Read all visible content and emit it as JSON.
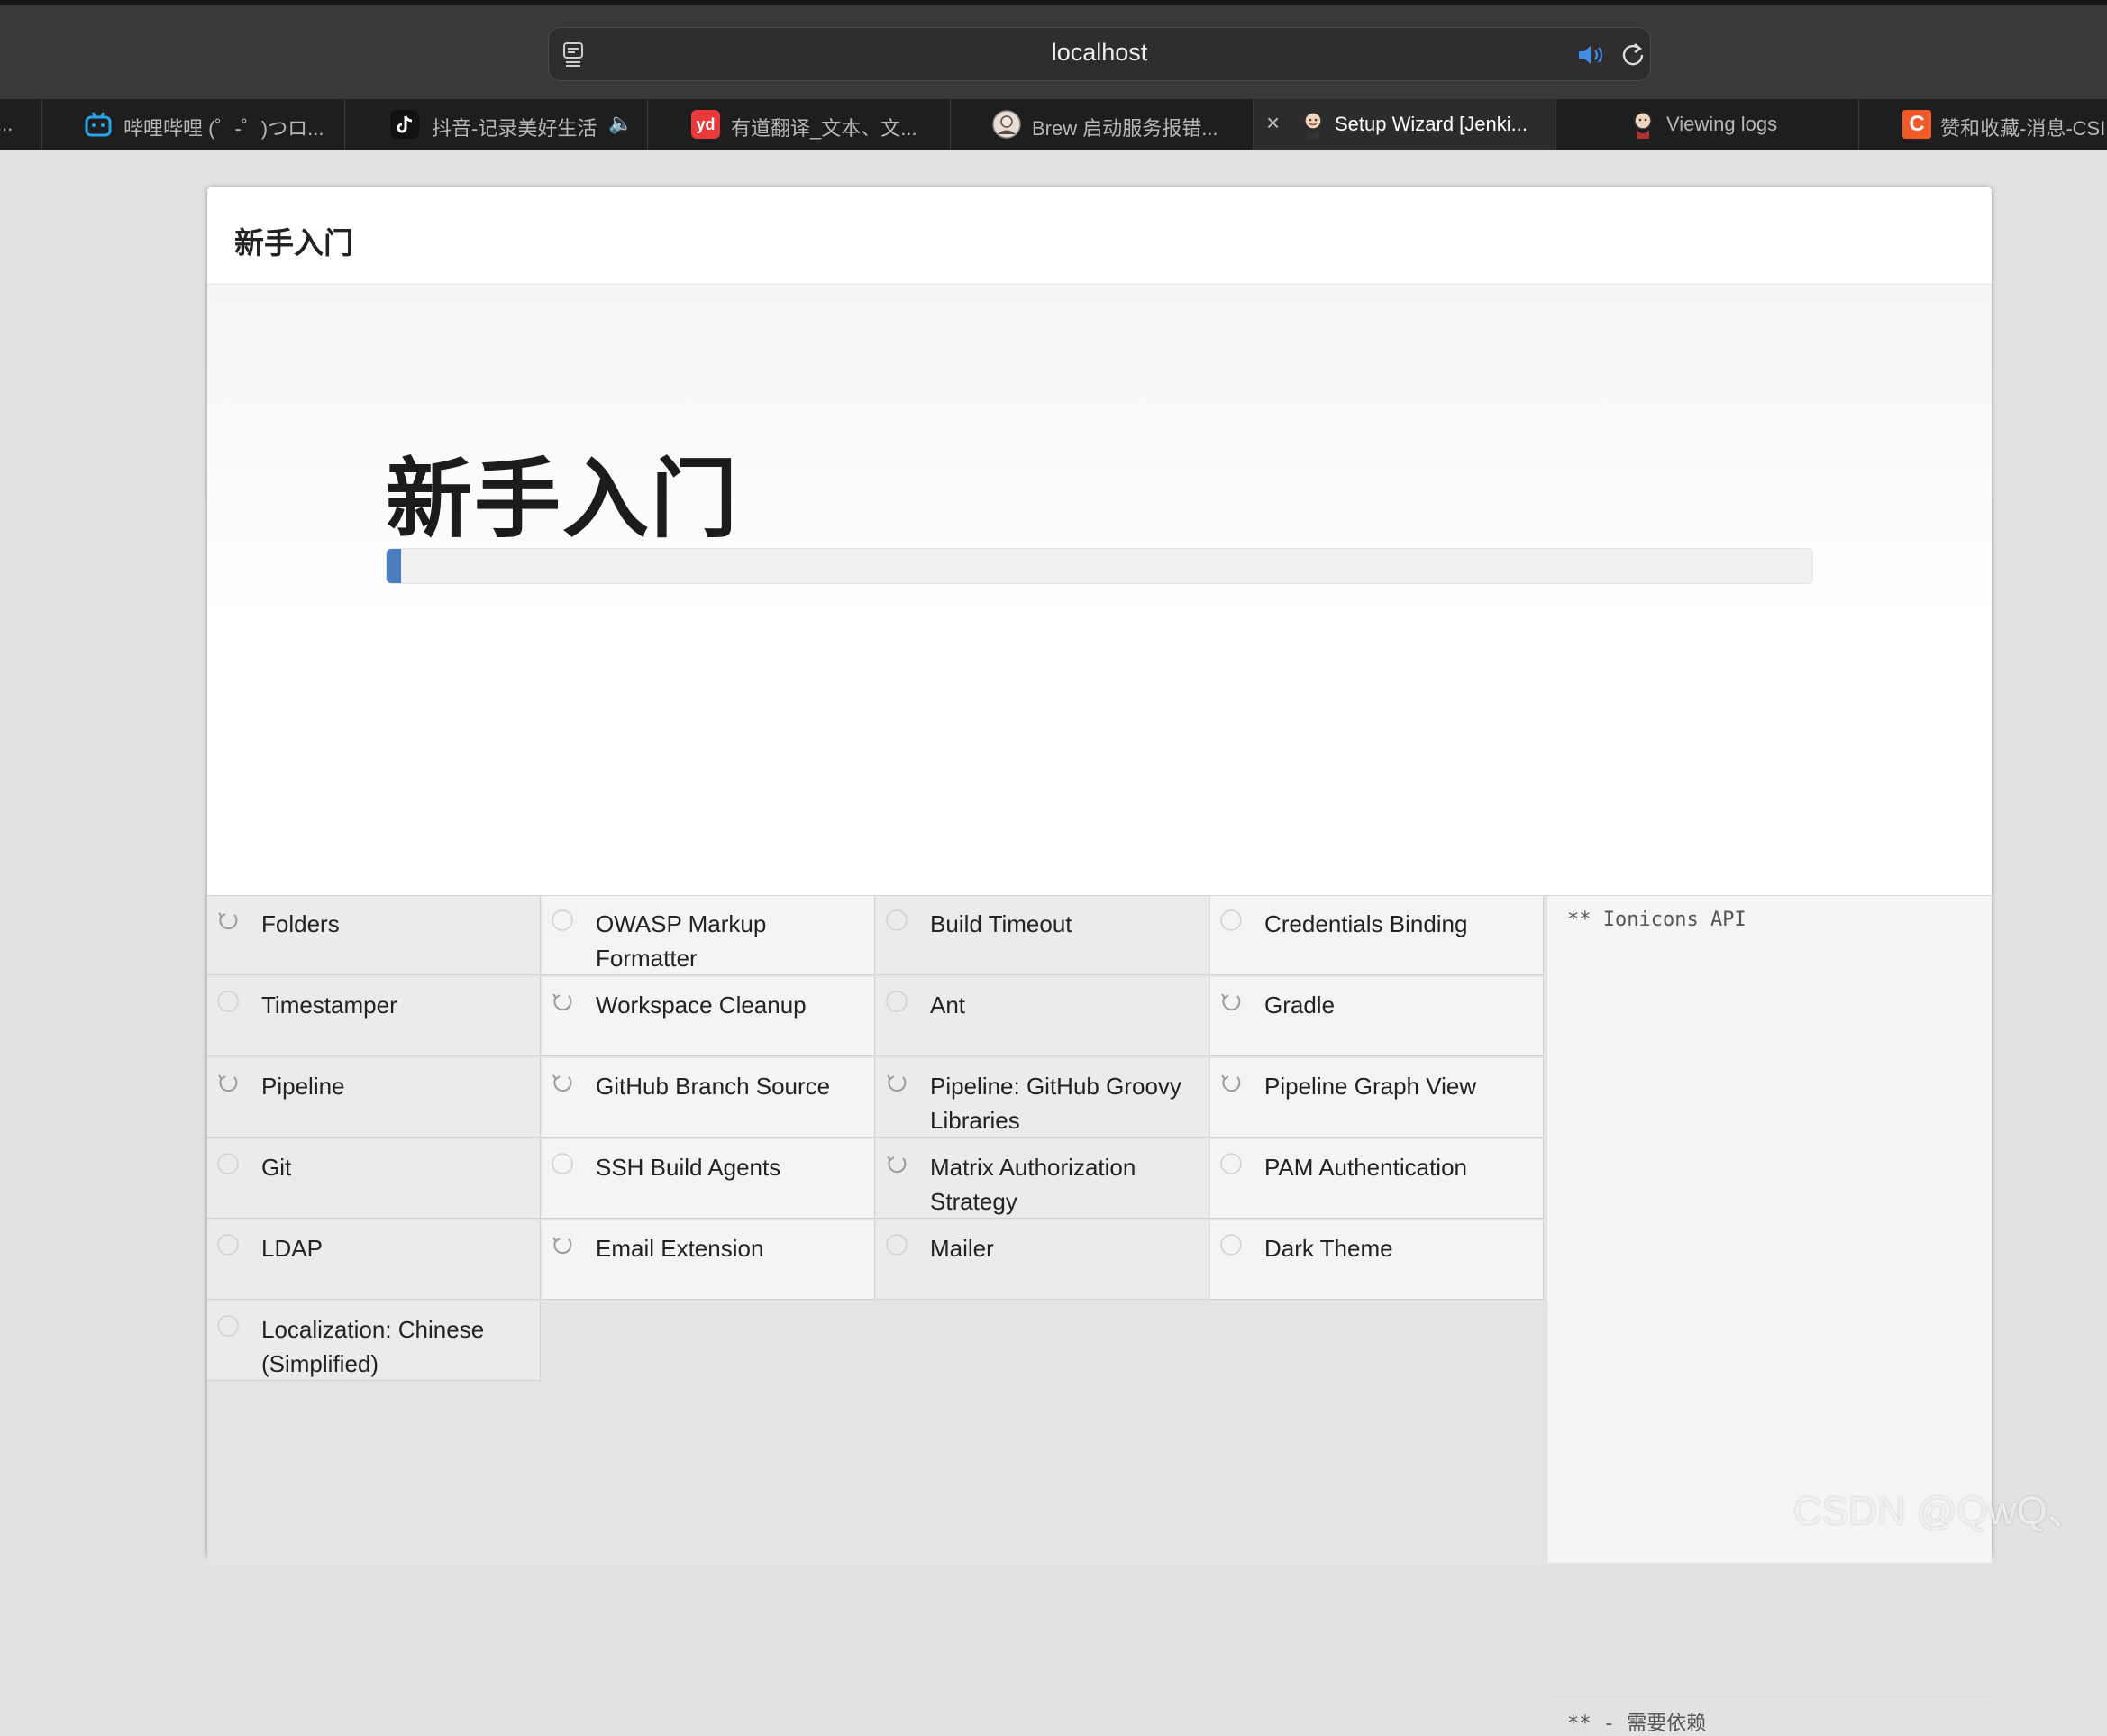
{
  "browser": {
    "url": "localhost",
    "tabs": [
      {
        "label": "..."
      },
      {
        "label": "哔哩哔哩 (゜-゜)つロ...",
        "icon": "bilibili-icon",
        "color": "#2aa3e8"
      },
      {
        "label": "抖音-记录美好生活",
        "icon": "douyin-icon",
        "color": "#111111",
        "sound": "speaker-icon"
      },
      {
        "label": "有道翻译_文本、文...",
        "icon": "youdao-icon",
        "color": "#e83a3a",
        "icon_text": "yd"
      },
      {
        "label": "Brew 启动服务报错...",
        "icon": "avatar-icon",
        "color": "#d9c9c0"
      },
      {
        "label": "Setup Wizard [Jenki...",
        "icon": "jenkins-icon",
        "color": "#d8b79b",
        "active": true
      },
      {
        "label": "Viewing logs",
        "icon": "jenkins-icon",
        "color": "#c99a8a"
      },
      {
        "label": "赞和收藏-消息-CSI",
        "icon": "csdn-icon",
        "color": "#f05a28",
        "icon_text": "C"
      }
    ]
  },
  "panel": {
    "header_title": "新手入门",
    "hero_title": "新手入门",
    "progress_percent": 1
  },
  "plugins": [
    {
      "name": "Folders",
      "status": "installing"
    },
    {
      "name": "OWASP Markup Formatter",
      "status": "pending"
    },
    {
      "name": "Build Timeout",
      "status": "pending"
    },
    {
      "name": "Credentials Binding",
      "status": "pending"
    },
    {
      "name": "Timestamper",
      "status": "pending"
    },
    {
      "name": "Workspace Cleanup",
      "status": "installing"
    },
    {
      "name": "Ant",
      "status": "pending"
    },
    {
      "name": "Gradle",
      "status": "installing"
    },
    {
      "name": "Pipeline",
      "status": "installing"
    },
    {
      "name": "GitHub Branch Source",
      "status": "installing"
    },
    {
      "name": "Pipeline: GitHub Groovy Libraries",
      "status": "installing"
    },
    {
      "name": "Pipeline Graph View",
      "status": "installing"
    },
    {
      "name": "Git",
      "status": "pending"
    },
    {
      "name": "SSH Build Agents",
      "status": "pending"
    },
    {
      "name": "Matrix Authorization Strategy",
      "status": "installing"
    },
    {
      "name": "PAM Authentication",
      "status": "pending"
    },
    {
      "name": "LDAP",
      "status": "pending"
    },
    {
      "name": "Email Extension",
      "status": "installing"
    },
    {
      "name": "Mailer",
      "status": "pending"
    },
    {
      "name": "Dark Theme",
      "status": "pending"
    },
    {
      "name": "Localization: Chinese (Simplified)",
      "status": "pending"
    }
  ],
  "log": {
    "line1": "** Ionicons API",
    "line2": "** - 需要依赖"
  },
  "watermark": "CSDN @QwQ、"
}
